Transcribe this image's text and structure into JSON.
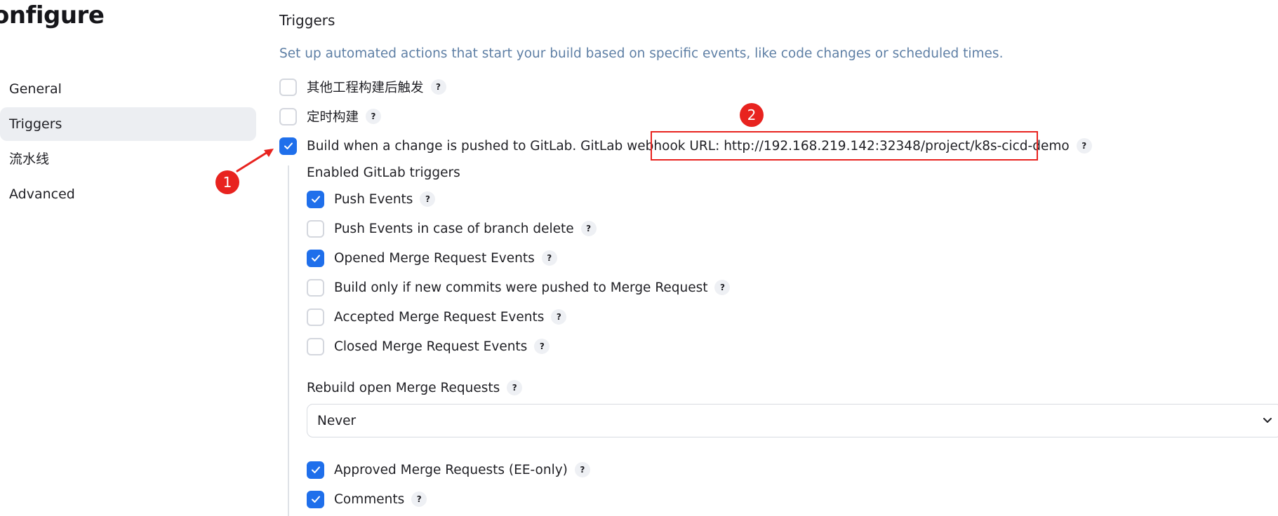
{
  "page": {
    "title": "onfigure"
  },
  "sidebar": {
    "items": [
      {
        "label": "General",
        "active": false
      },
      {
        "label": "Triggers",
        "active": true
      },
      {
        "label": "流水线",
        "active": false
      },
      {
        "label": "Advanced",
        "active": false
      }
    ]
  },
  "triggers": {
    "title": "Triggers",
    "description": "Set up automated actions that start your build based on specific events, like code changes or scheduled times.",
    "options": [
      {
        "label": "其他工程构建后触发",
        "checked": false
      },
      {
        "label": "定时构建",
        "checked": false
      },
      {
        "label": "Build when a change is pushed to GitLab. GitLab webhook URL: http://192.168.219.142:32348/project/k8s-cicd-demo",
        "checked": true
      }
    ],
    "gitlab": {
      "heading": "Enabled GitLab triggers",
      "options": [
        {
          "label": "Push Events",
          "checked": true
        },
        {
          "label": "Push Events in case of branch delete",
          "checked": false
        },
        {
          "label": "Opened Merge Request Events",
          "checked": true
        },
        {
          "label": "Build only if new commits were pushed to Merge Request",
          "checked": false
        },
        {
          "label": "Accepted Merge Request Events",
          "checked": false
        },
        {
          "label": "Closed Merge Request Events",
          "checked": false
        }
      ],
      "rebuild": {
        "label": "Rebuild open Merge Requests",
        "value": "Never"
      },
      "more_options": [
        {
          "label": "Approved Merge Requests (EE-only)",
          "checked": true
        },
        {
          "label": "Comments",
          "checked": true
        }
      ]
    },
    "help_symbol": "?"
  },
  "annotations": {
    "one": "1",
    "two": "2"
  },
  "colors": {
    "accent": "#1f6feb",
    "annotation": "#e8231f",
    "description": "#5e7fa5"
  }
}
